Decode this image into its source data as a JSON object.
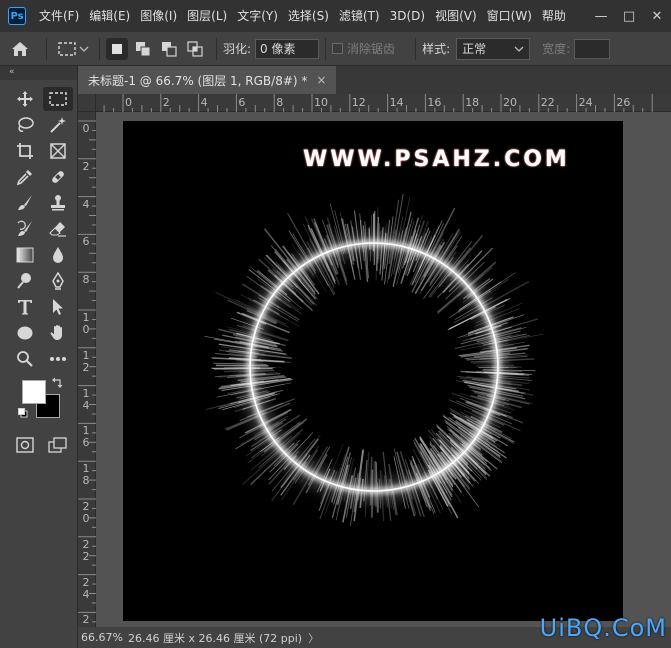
{
  "app": {
    "logo_text": "Ps"
  },
  "menu": [
    "文件(F)",
    "编辑(E)",
    "图像(I)",
    "图层(L)",
    "文字(Y)",
    "选择(S)",
    "滤镜(T)",
    "3D(D)",
    "视图(V)",
    "窗口(W)",
    "帮助"
  ],
  "window_controls": {
    "minimize": "—",
    "maximize": "□",
    "close": "✕"
  },
  "options": {
    "feather_label": "羽化:",
    "feather_value": "0 像素",
    "antialias_label": "消除锯齿",
    "style_label": "样式:",
    "style_value": "正常",
    "width_label": "宽度:"
  },
  "document": {
    "tab_title": "未标题-1 @ 66.7% (图层 1, RGB/8#) *",
    "tab_close": "×",
    "watermark": "WWW.PSAHZ.COM"
  },
  "ruler": {
    "top_labels": [
      "0",
      "2",
      "4",
      "6",
      "8",
      "10",
      "12",
      "14",
      "16",
      "18",
      "20",
      "22",
      "24",
      "26"
    ],
    "left_labels": [
      "0",
      "2",
      "4",
      "6",
      "8",
      "10",
      "12",
      "14",
      "16",
      "18",
      "20",
      "22",
      "24",
      "26"
    ]
  },
  "status": {
    "zoom": "66.67%",
    "doc_info": "26.46 厘米 x 26.46 厘米 (72 ppi)",
    "arrow": "〉"
  },
  "colors": {
    "foreground": "#ffffff",
    "background": "#000000"
  },
  "site_logo": "UiBQ.CoM"
}
